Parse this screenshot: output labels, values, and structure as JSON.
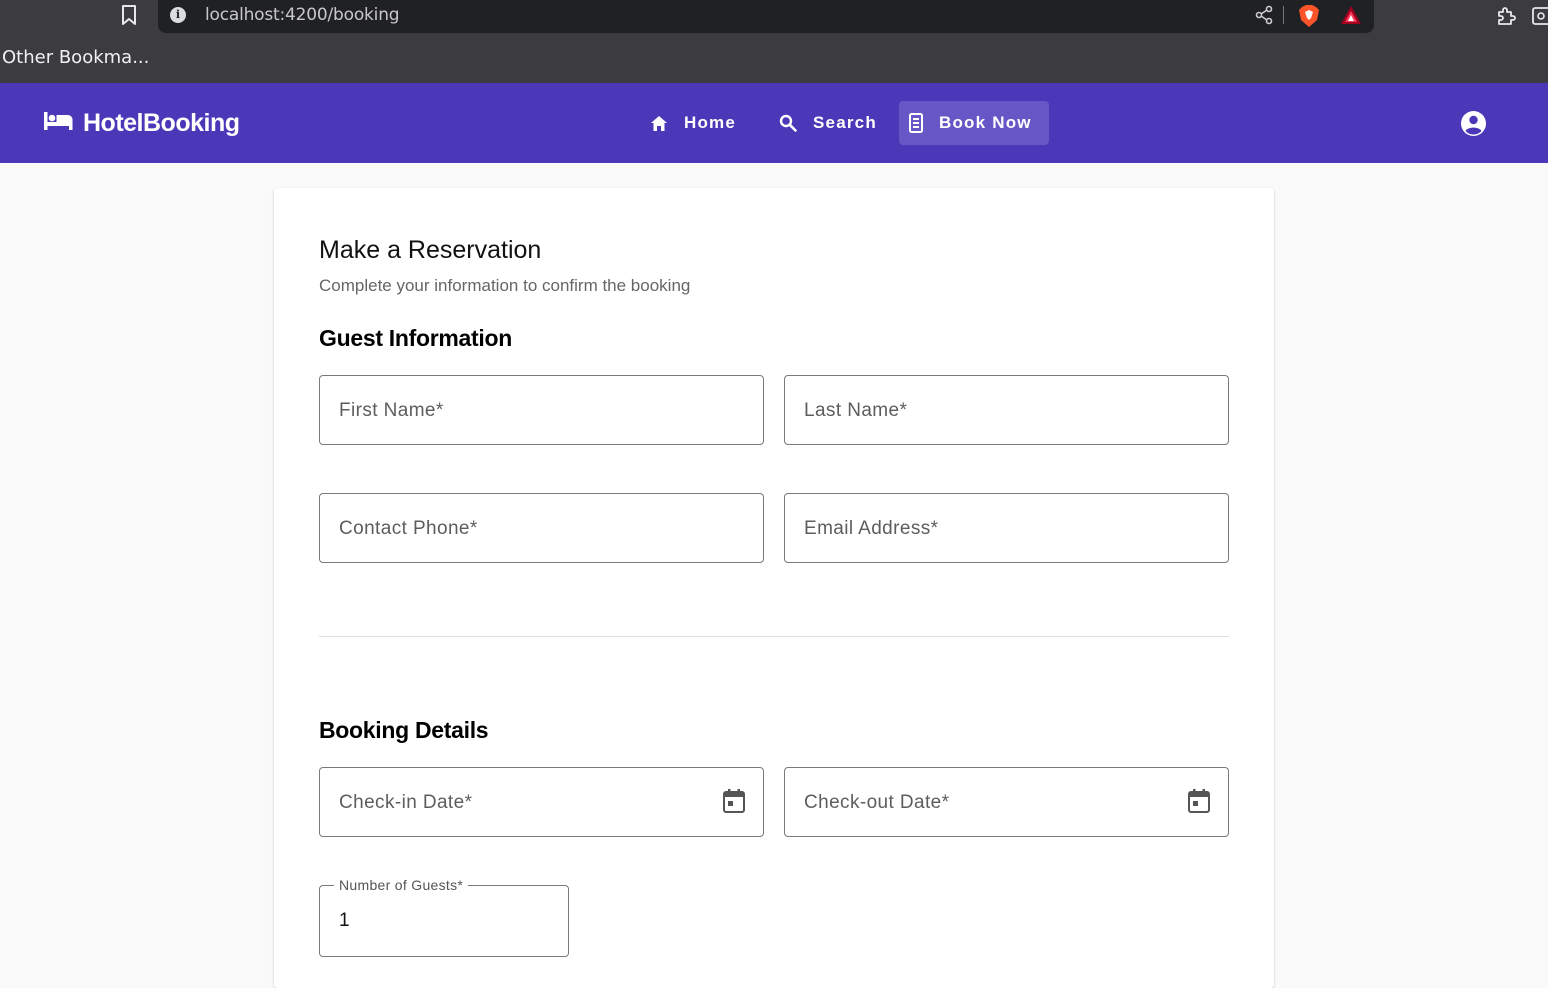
{
  "browser": {
    "url": "localhost:4200/booking",
    "bookmarks": [
      "Other Bookma..."
    ]
  },
  "navbar": {
    "brand": "HotelBooking",
    "links": [
      {
        "label": "Home",
        "icon": "home-icon"
      },
      {
        "label": "Search",
        "icon": "search-icon"
      },
      {
        "label": "Book Now",
        "icon": "book-icon",
        "active": true
      }
    ],
    "account_icon": "account-circle-icon",
    "bg_color": "#4a38b8"
  },
  "form": {
    "title": "Make a Reservation",
    "subtitle": "Complete your information to confirm the booking",
    "guest_section": {
      "title": "Guest Information",
      "first_name_placeholder": "First Name*",
      "last_name_placeholder": "Last Name*",
      "phone_placeholder": "Contact Phone*",
      "email_placeholder": "Email Address*"
    },
    "booking_section": {
      "title": "Booking Details",
      "checkin_placeholder": "Check-in Date*",
      "checkout_placeholder": "Check-out Date*",
      "guests_label": "Number of Guests*",
      "guests_value": "1"
    }
  }
}
